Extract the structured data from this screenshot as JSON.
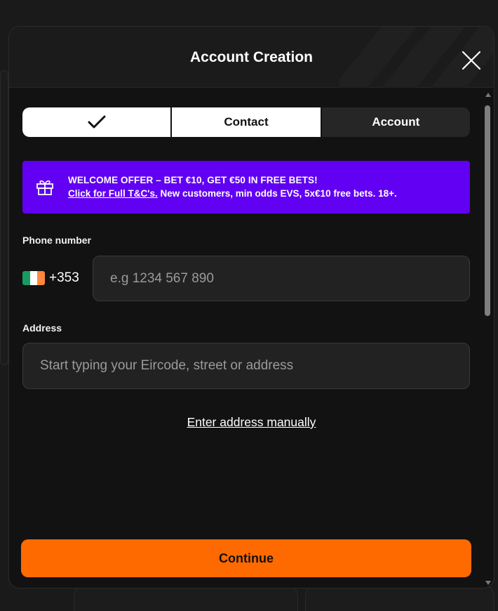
{
  "modal": {
    "title": "Account Creation"
  },
  "steps": [
    {
      "label": "",
      "state": "done",
      "icon": "checkmark-icon"
    },
    {
      "label": "Contact",
      "state": "active"
    },
    {
      "label": "Account",
      "state": "inactive"
    }
  ],
  "offer": {
    "icon": "gift-icon",
    "title": "WELCOME OFFER – BET €10, GET €50 IN FREE BETS!",
    "link_text": "Click for Full T&C's.",
    "terms_text": " New customers, min odds EVS, 5x€10 free bets. 18+.",
    "color": "#6100f2"
  },
  "phone": {
    "label": "Phone number",
    "country_code": "+353",
    "flag_colors": [
      "#169b62",
      "#ffffff",
      "#ff883e"
    ],
    "placeholder": "e.g 1234 567 890",
    "value": ""
  },
  "address": {
    "label": "Address",
    "placeholder": "Start typing your Eircode, street or address",
    "value": "",
    "manual_link": "Enter address manually"
  },
  "continue_label": "Continue",
  "colors": {
    "accent": "#ff6a00",
    "background": "#121212"
  }
}
